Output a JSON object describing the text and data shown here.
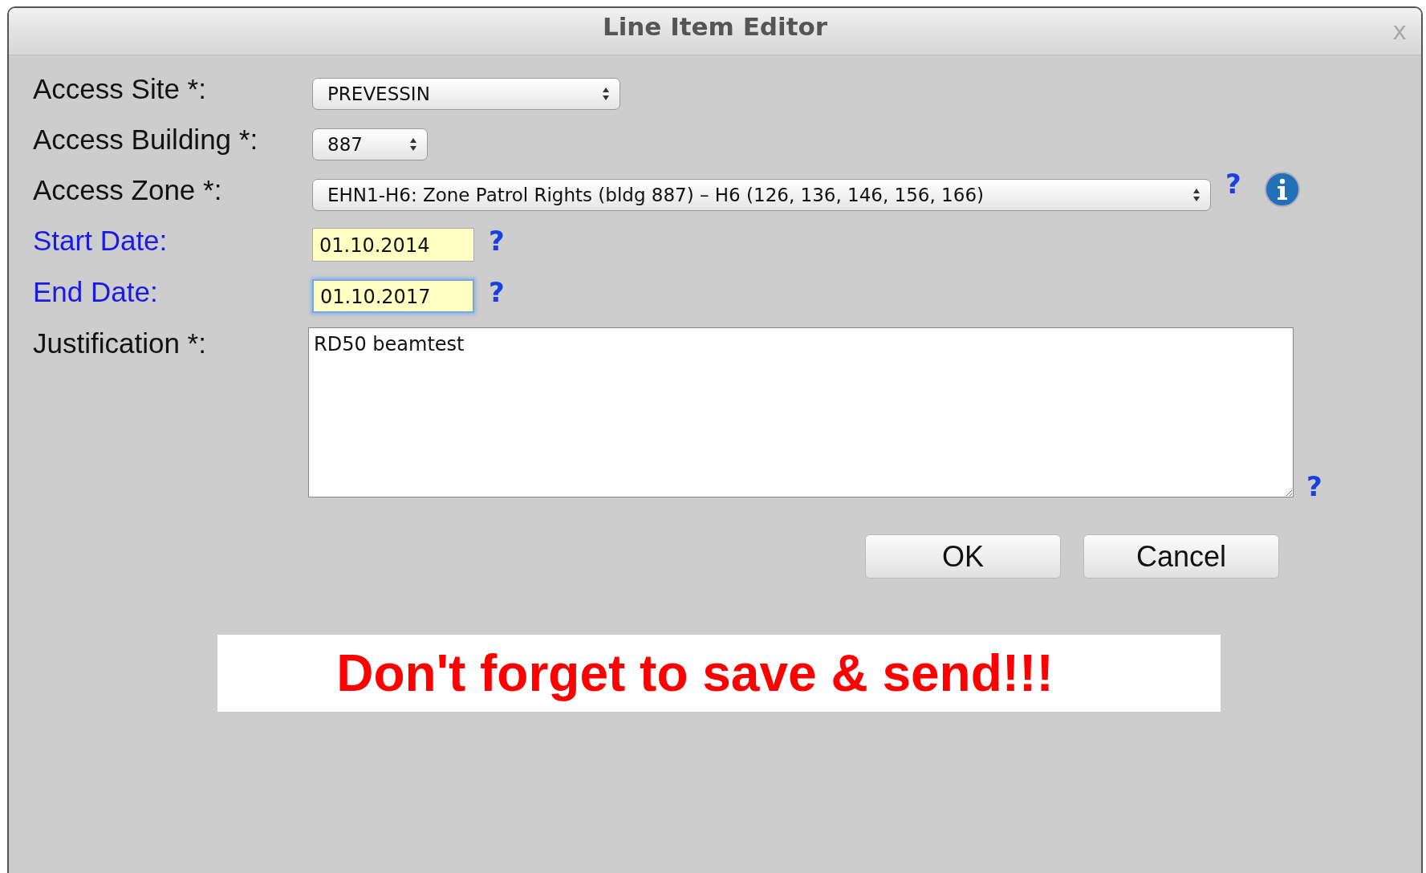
{
  "window": {
    "title": "Line Item Editor",
    "close": "x"
  },
  "fields": [
    {
      "kind": "select",
      "label": "Access Site *:",
      "required": true,
      "value": "PREVESSIN"
    },
    {
      "kind": "select",
      "label": "Access Building *:",
      "required": true,
      "value": "887"
    },
    {
      "kind": "select",
      "label": "Access Zone *:",
      "required": true,
      "value": "EHN1-H6: Zone Patrol Rights (bldg 887) – H6 (126, 136, 146, 156, 166)",
      "help": "?",
      "info": true
    },
    {
      "kind": "date",
      "label": "Start Date:",
      "required": false,
      "value": "01.10.2014",
      "focused": false,
      "help": "?"
    },
    {
      "kind": "date",
      "label": "End Date:",
      "required": false,
      "value": "01.10.2017",
      "focused": true,
      "help": "?"
    },
    {
      "kind": "textarea",
      "label": "Justification *:",
      "required": true,
      "value": "RD50 beamtest",
      "help": "?"
    }
  ],
  "buttons": [
    "OK",
    "Cancel"
  ],
  "banner": "Don't forget to save & send!!!"
}
